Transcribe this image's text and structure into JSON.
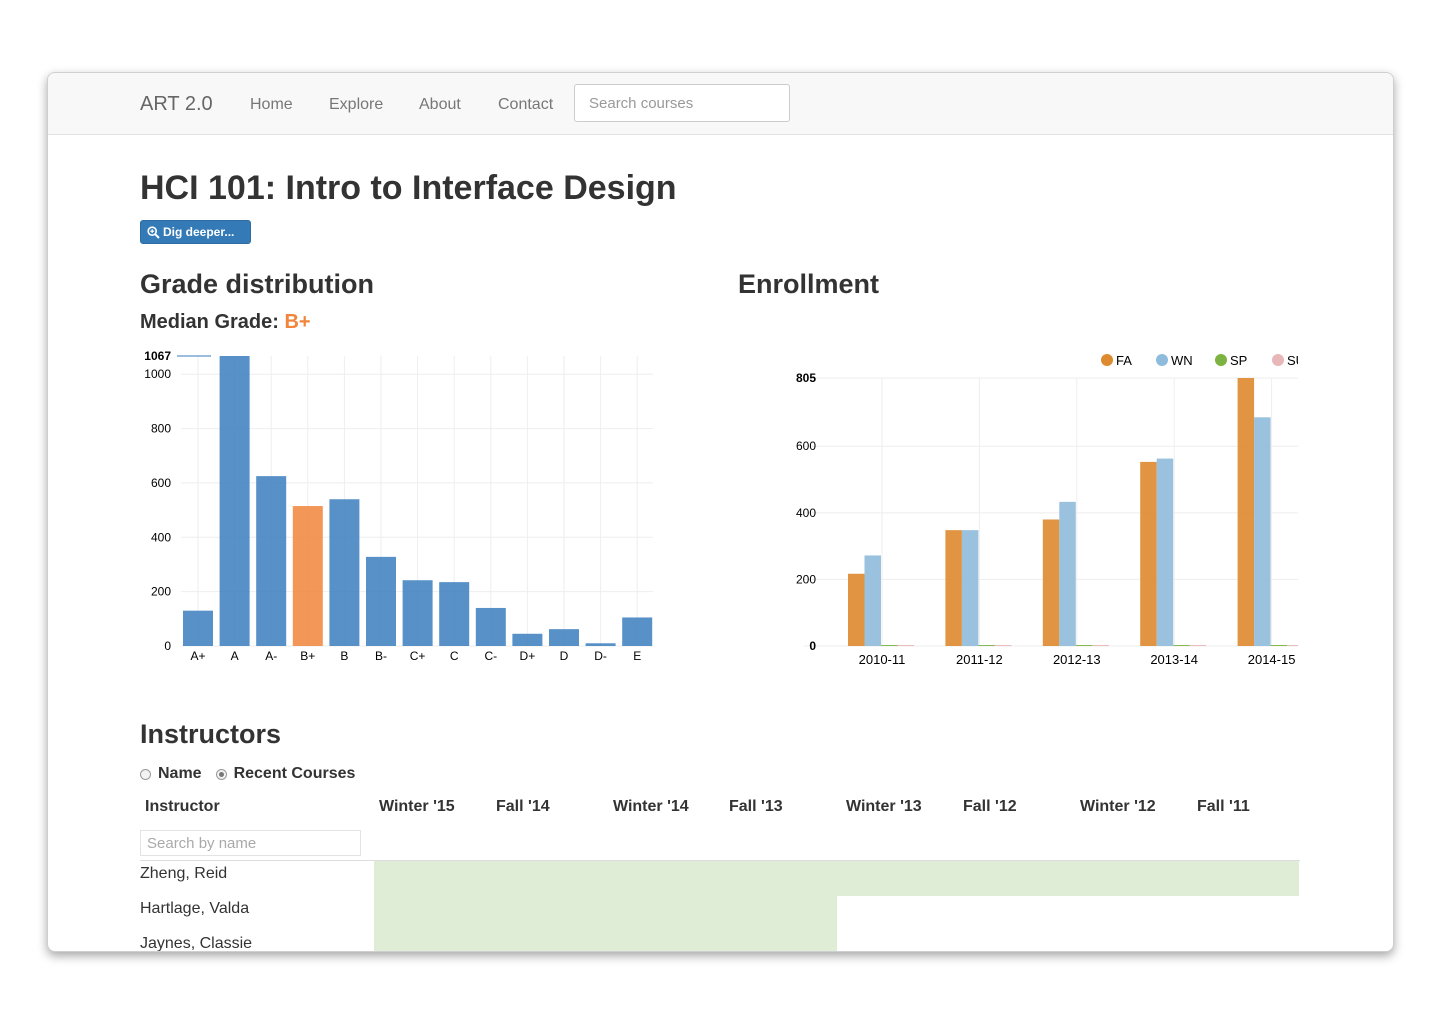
{
  "navbar": {
    "brand": "ART 2.0",
    "links": [
      "Home",
      "Explore",
      "About",
      "Contact"
    ],
    "search_placeholder": "Search courses"
  },
  "page": {
    "title": "HCI 101: Intro to Interface Design",
    "dig_button": "Dig deeper..."
  },
  "grades": {
    "section_title": "Grade distribution",
    "median_label": "Median Grade:",
    "median_value": "B+"
  },
  "enrollment": {
    "section_title": "Enrollment"
  },
  "colors": {
    "grade_bar": "#3a7ebe",
    "grade_highlight": "#f0853b",
    "FA": "#de8a2e",
    "WN": "#8fbbdc",
    "SP": "#7cb342",
    "SU": "#e8b7b7",
    "instructor_bar": "#dfecd6"
  },
  "chart_data": [
    {
      "type": "bar",
      "categories": [
        "A+",
        "A",
        "A-",
        "B+",
        "B",
        "B-",
        "C+",
        "C",
        "C-",
        "D+",
        "D",
        "D-",
        "E"
      ],
      "values": [
        130,
        1067,
        625,
        515,
        540,
        328,
        242,
        235,
        140,
        45,
        62,
        10,
        105
      ],
      "highlight": "B+",
      "max_marker": "1067",
      "ylim": [
        0,
        1067
      ],
      "yticks": [
        0,
        200,
        400,
        600,
        800,
        1000
      ],
      "grid": true
    },
    {
      "type": "bar",
      "categories": [
        "2010-11",
        "2011-12",
        "2012-13",
        "2013-14",
        "2014-15"
      ],
      "series": [
        {
          "name": "FA",
          "values": [
            217,
            348,
            380,
            553,
            805
          ]
        },
        {
          "name": "WN",
          "values": [
            272,
            348,
            433,
            563,
            687
          ]
        },
        {
          "name": "SP",
          "values": [
            0,
            0,
            0,
            0,
            0
          ]
        },
        {
          "name": "SU",
          "values": [
            0,
            0,
            0,
            0,
            0
          ]
        }
      ],
      "ylim": [
        0,
        805
      ],
      "yticks": [
        0,
        200,
        400,
        600
      ],
      "max_marker": "805",
      "legend": "top-right",
      "grid": true
    }
  ],
  "instructors": {
    "section_title": "Instructors",
    "sort_options": [
      {
        "label": "Name",
        "selected": false
      },
      {
        "label": "Recent Courses",
        "selected": true
      }
    ],
    "column_header": "Instructor",
    "terms": [
      "Winter '15",
      "Fall '14",
      "Winter '14",
      "Fall '13",
      "Winter '13",
      "Fall '12",
      "Winter '12",
      "Fall '11"
    ],
    "search_placeholder": "Search by name",
    "rows": [
      {
        "name": "Zheng, Reid",
        "taught_fraction": 1.0
      },
      {
        "name": "Hartlage, Valda",
        "taught_fraction": 0.5
      },
      {
        "name": "Jaynes, Classie",
        "taught_fraction": 0.5
      }
    ]
  }
}
